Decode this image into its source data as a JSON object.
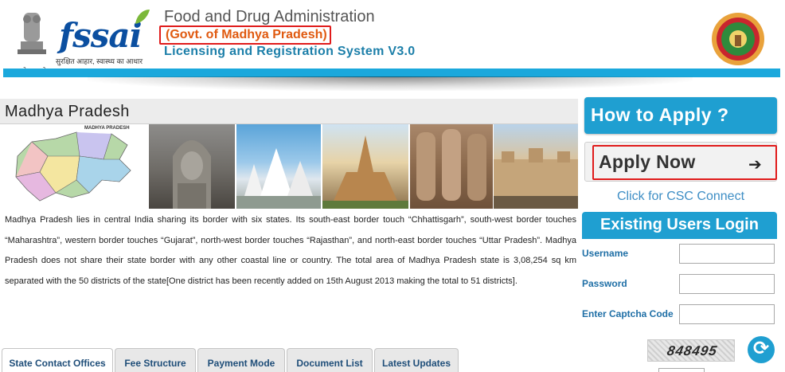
{
  "header": {
    "org_title": "Food and Drug Administration",
    "govt_label": "(Govt. of Madhya Pradesh)",
    "system_title": "Licensing and Registration System V3.0",
    "fssai_logo_text": "fssai",
    "fssai_tagline": "सुरक्षित आहार, स्वास्थ्य का आधार",
    "emblem_motto": "सत्यमेव जयते"
  },
  "main": {
    "state_heading": "Madhya Pradesh",
    "map_title": "MADHYA PRADESH",
    "description": "Madhya Pradesh lies in central India sharing its border with six states. Its south-east border touch “Chhattisgarh”, south-west border touches “Maharashtra”, western border touches “Gujarat”, north-west border touches “Rajasthan”, and north-east border touches “Uttar Pradesh”. Madhya Pradesh does not share their state border with any other coastal line or country. The total area of Madhya Pradesh state is 3,08,254 sq km separated with the 50 districts of the state[One district has been recently added on 15th August 2013 making the total to 51 districts]."
  },
  "tabs": [
    {
      "label": "State Contact Offices",
      "active": true
    },
    {
      "label": "Fee Structure",
      "active": false
    },
    {
      "label": "Payment Mode",
      "active": false
    },
    {
      "label": "Document List",
      "active": false
    },
    {
      "label": "Latest Updates",
      "active": false
    }
  ],
  "sidebar": {
    "how_to_apply": "How to Apply ?",
    "apply_now": "Apply Now",
    "csc_link": "Click for CSC Connect",
    "login_title": "Existing Users Login",
    "username_label": "Username",
    "password_label": "Password",
    "captcha_label": "Enter Captcha Code",
    "captcha_text": "848495"
  },
  "colors": {
    "accent_blue": "#1f9fd1",
    "header_bar": "#1ba8dc",
    "highlight_red": "#e01b1b",
    "govt_orange": "#e05a10"
  }
}
